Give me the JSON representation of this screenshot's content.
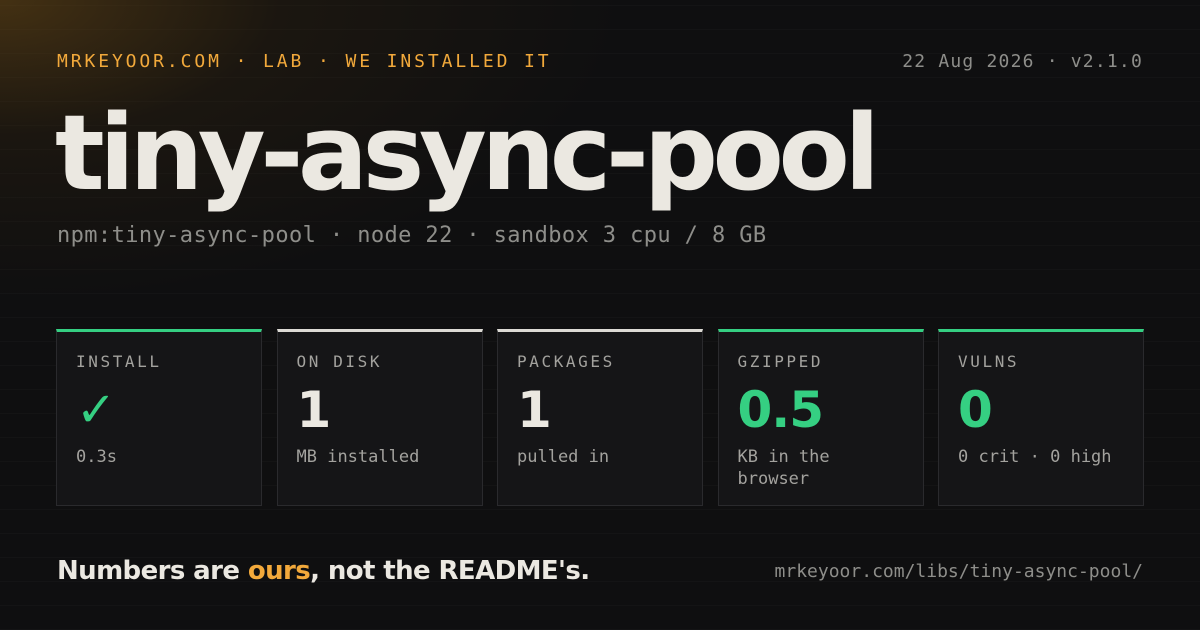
{
  "header": {
    "kicker": "MRKEYOOR.COM · LAB · WE INSTALLED IT",
    "meta": "22 Aug 2026 · v2.1.0"
  },
  "title": "tiny-async-pool",
  "subtitle": "npm:tiny-async-pool · node 22 · sandbox 3 cpu / 8 GB",
  "colors": {
    "accent": "#f2a93b",
    "good": "#35cf82",
    "text": "#ebe8e1",
    "muted": "#8e8e8a",
    "background": "#0f0f10"
  },
  "cards": [
    {
      "label": "INSTALL",
      "value": "✓",
      "note": "0.3s",
      "status": "good",
      "icon": "check-icon"
    },
    {
      "label": "ON DISK",
      "value": "1",
      "note": "MB installed",
      "status": "neutral"
    },
    {
      "label": "PACKAGES",
      "value": "1",
      "note": "pulled in",
      "status": "neutral"
    },
    {
      "label": "GZIPPED",
      "value": "0.5",
      "note": "KB in the browser",
      "status": "good"
    },
    {
      "label": "VULNS",
      "value": "0",
      "note": "0 crit · 0 high",
      "status": "good"
    }
  ],
  "footer": {
    "tagline_before": "Numbers are ",
    "tagline_highlight": "ours",
    "tagline_after": ", not the README's.",
    "url": "mrkeyoor.com/libs/tiny-async-pool/"
  }
}
